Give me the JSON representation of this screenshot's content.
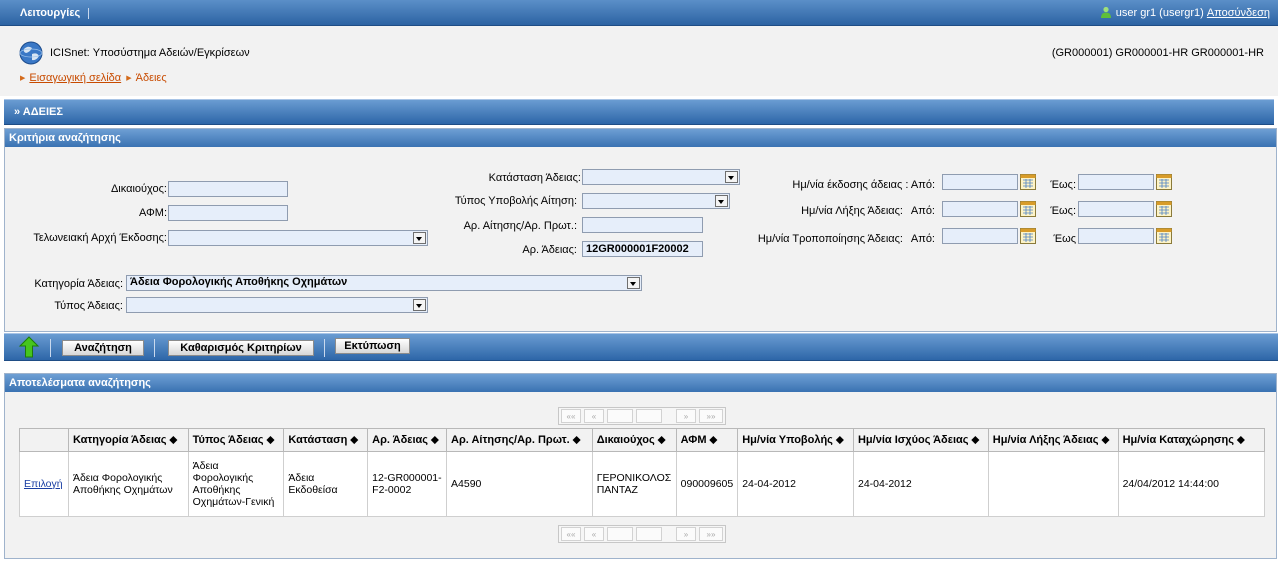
{
  "topbar": {
    "menu_label": "Λειτουργίες",
    "user_label": "user gr1 (usergr1)",
    "logout_label": "Αποσύνδεση",
    "bg_color": "#2c63a3"
  },
  "header": {
    "system_title": "ICISnet: Υποσύστημα Αδειών/Εγκρίσεων",
    "system_code": "(GR000001) GR000001-HR GR000001-HR",
    "breadcrumb": {
      "home": "Εισαγωγική σελίδα",
      "current": "Άδειες"
    }
  },
  "section_title": "» ΑΔΕΙΕΣ",
  "criteria": {
    "title": "Κριτήρια αναζήτησης",
    "beneficiary_label": "Δικαιούχος:",
    "beneficiary_value": "",
    "afm_label": "ΑΦΜ:",
    "afm_value": "",
    "customs_label": "Τελωνειακή Αρχή Έκδοσης:",
    "customs_value": "",
    "status_label": "Κατάσταση Άδειας:",
    "status_value": "",
    "submission_type_label": "Τύπος Υποβολής Αίτηση:",
    "submission_type_value": "",
    "application_no_label": "Αρ. Αίτησης/Αρ. Πρωτ.:",
    "application_no_value": "",
    "license_no_label": "Αρ. Άδειας:",
    "license_no_value": "12GR000001F20002",
    "issue_date_label": "Ημ/νία έκδοσης άδειας :",
    "expiry_date_label": "Ημ/νία Λήξης Άδειας:",
    "modification_date_label": "Ημ/νία Τροποποίησης Άδειας:",
    "from_label": "Από:",
    "to_label": "Έως:",
    "to_label_alt": "Έως",
    "category_label": "Κατηγορία Άδειας:",
    "category_value": "Άδεια Φορολογικής Αποθήκης Οχημάτων",
    "license_type_label": "Τύπος Άδειας:",
    "license_type_value": ""
  },
  "toolbar": {
    "search_label": "Αναζήτηση",
    "clear_label": "Καθαρισμός Κριτηρίων",
    "print_label": "Εκτύπωση"
  },
  "results": {
    "title": "Αποτελέσματα αναζήτησης",
    "pager": {
      "first": "««",
      "prev": "«",
      "next": "»",
      "last": "»»"
    },
    "columns": [
      "",
      "Κατηγορία Άδειας ⬥",
      "Τύπος Άδειας ⬥",
      "Κατάσταση ⬥",
      "Αρ. Άδειας ⬥",
      "Αρ. Αίτησης/Αρ. Πρωτ. ⬥",
      "Δικαιούχος ⬥",
      "ΑΦΜ ⬥",
      "Ημ/νία Υποβολής ⬥",
      "Ημ/νία Ισχύος Άδειας ⬥",
      "Ημ/νία Λήξης Άδειας ⬥",
      "Ημ/νία Καταχώρησης ⬥"
    ],
    "rows": [
      {
        "action": "Επιλογή",
        "category": "Άδεια Φορολογικής Αποθήκης Οχημάτων",
        "type": "Άδεια Φορολογικής Αποθήκης Οχημάτων-Γενική",
        "status": "Άδεια Εκδοθείσα",
        "license_no": "12-GR000001-F2-0002",
        "application_no": "A4590",
        "beneficiary": "ΓΕΡΟΝΙΚΟΛΟΣ ΠΑΝΤΑΖ",
        "afm": "090009605",
        "submission_date": "24-04-2012",
        "validity_date": "24-04-2012",
        "expiry_date": "",
        "registration_date": "24/04/2012 14:44:00"
      }
    ]
  }
}
